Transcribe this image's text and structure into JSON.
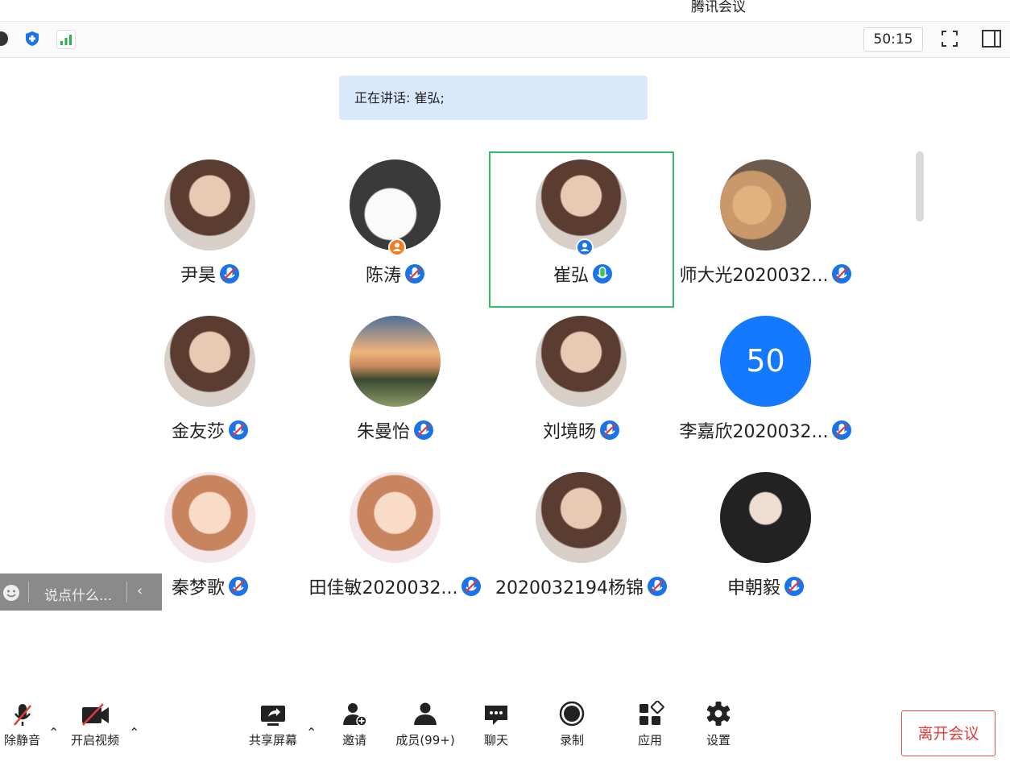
{
  "window": {
    "title": "腾讯会议"
  },
  "topbar": {
    "timer": "50:15"
  },
  "speaking": {
    "text": "正在讲话: 崔弘;"
  },
  "participants": [
    {
      "name": "尹昊",
      "avatar": "photo",
      "mic": "muted"
    },
    {
      "name": "陈涛",
      "avatar": "ghost",
      "mic": "muted",
      "role_badge": "host-icon"
    },
    {
      "name": "崔弘",
      "avatar": "photo",
      "mic": "speaking",
      "role_badge": "cohost-icon",
      "active": true
    },
    {
      "name": "师大光2020032...",
      "avatar": "cats",
      "mic": "muted"
    },
    {
      "name": "金友莎",
      "avatar": "photo",
      "mic": "muted"
    },
    {
      "name": "朱曼怡",
      "avatar": "sunset",
      "mic": "muted"
    },
    {
      "name": "刘境旸",
      "avatar": "photo",
      "mic": "muted"
    },
    {
      "name": "李嘉欣2020032...",
      "avatar": "number",
      "avatar_text": "50",
      "mic": "muted"
    },
    {
      "name": "秦梦歌",
      "avatar": "anime",
      "mic": "muted"
    },
    {
      "name": "田佳敏2020032...",
      "avatar": "anime",
      "mic": "muted"
    },
    {
      "name": "2020032194杨锦",
      "avatar": "photo",
      "mic": "muted"
    },
    {
      "name": "申朝毅",
      "avatar": "illustration",
      "mic": "muted"
    }
  ],
  "chat": {
    "placeholder": "说点什么..."
  },
  "toolbar": {
    "unmute": "除静音",
    "video": "开启视频",
    "share": "共享屏幕",
    "invite": "邀请",
    "members": "成员(99+)",
    "chat": "聊天",
    "record": "录制",
    "apps": "应用",
    "settings": "设置",
    "leave": "离开会议"
  },
  "colors": {
    "accent": "#1479ff",
    "active_border": "#2fbf6b",
    "leave": "#e03c3c",
    "speaking_bg": "#d9e8fb"
  }
}
